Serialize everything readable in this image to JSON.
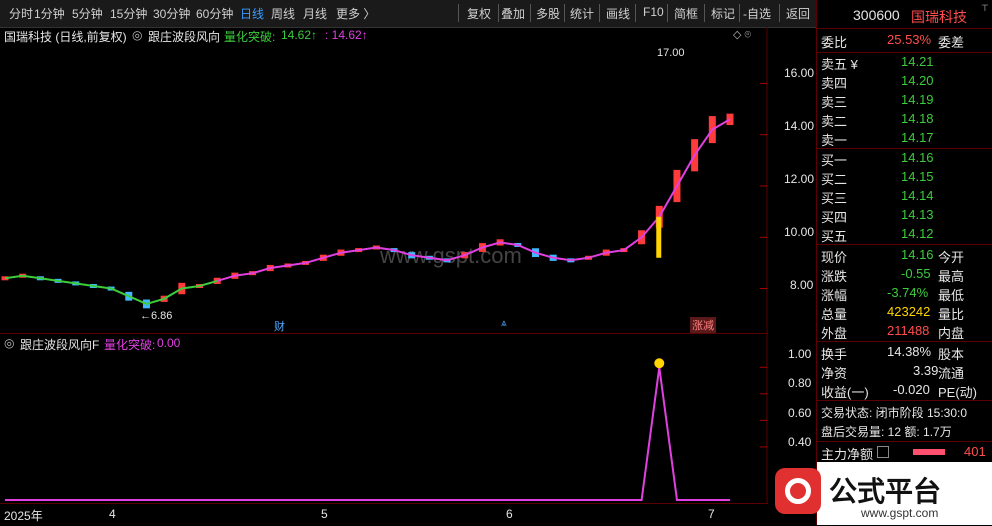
{
  "toolbar": {
    "periods": [
      "分时",
      "1分钟",
      "5分钟",
      "15分钟",
      "30分钟",
      "60分钟",
      "日线",
      "周线",
      "月线",
      "更多 〉"
    ],
    "active_period": "日线",
    "actions": [
      "复权",
      "叠加",
      "多股",
      "统计",
      "画线",
      "F10",
      "简框",
      "标记",
      "-自选",
      "返回"
    ]
  },
  "chart_title": {
    "stock": "国瑞科技 (日线,前复权)",
    "indicator": "跟庄波段风向",
    "label": "量化突破:",
    "val1": "14.62↑",
    "val2": ": 14.62↑"
  },
  "y_axis_main": [
    "16.00",
    "14.00",
    "12.00",
    "10.00",
    "8.00"
  ],
  "y_axis_sub": [
    "1.00",
    "0.80",
    "0.60",
    "0.40"
  ],
  "time_axis": [
    "2025年",
    "4",
    "5",
    "6",
    "7"
  ],
  "annotations": {
    "high": "17.00",
    "low": "←6.86",
    "event1": "财",
    "event2": "涨减"
  },
  "watermark": "www.gspt.com",
  "sub_title": {
    "name": "跟庄波段风向F",
    "label": "量化突破:",
    "value": "0.00"
  },
  "panel": {
    "code": "300600",
    "name": "国瑞科技",
    "weibi_label": "委比",
    "weibi_value": "25.53%",
    "weicha_label": "委差",
    "asks": [
      {
        "label": "卖五 ¥",
        "price": "14.21"
      },
      {
        "label": "卖四",
        "price": "14.20"
      },
      {
        "label": "卖三",
        "price": "14.19"
      },
      {
        "label": "卖二",
        "price": "14.18"
      },
      {
        "label": "卖一",
        "price": "14.17"
      }
    ],
    "bids": [
      {
        "label": "买一",
        "price": "14.16"
      },
      {
        "label": "买二",
        "price": "14.15"
      },
      {
        "label": "买三",
        "price": "14.14"
      },
      {
        "label": "买四",
        "price": "14.13"
      },
      {
        "label": "买五",
        "price": "14.12"
      }
    ],
    "quote": [
      {
        "label": "现价",
        "value": "14.16",
        "label2": "今开"
      },
      {
        "label": "涨跌",
        "value": "-0.55",
        "label2": "最高"
      },
      {
        "label": "涨幅",
        "value": "-3.74%",
        "label2": "最低"
      },
      {
        "label": "总量",
        "value": "423242",
        "label2": "量比"
      },
      {
        "label": "外盘",
        "value": "211488",
        "label2": "内盘"
      }
    ],
    "stats": [
      {
        "label": "换手",
        "value": "14.38%",
        "label2": "股本"
      },
      {
        "label": "净资",
        "value": "3.39",
        "label2": "流通"
      },
      {
        "label": "收益(一)",
        "value": "-0.020",
        "label2": "PE(动)"
      }
    ],
    "trade_status": "交易状态: 闭市阶段 15:30:0",
    "after_hours": "盘后交易量: 12  额: 1.7万",
    "main_flow_label": "主力净额",
    "main_flow_value": "401",
    "brand": "公式平台",
    "brand_url": "www.gspt.com"
  },
  "chart_data": {
    "type": "line",
    "x_ticks": [
      "2025年",
      "4",
      "5",
      "6",
      "7"
    ],
    "ylim_main": [
      6.5,
      17.5
    ],
    "y_ticks_main": [
      8,
      10,
      12,
      14,
      16
    ],
    "series": [
      {
        "color": "#e040e0",
        "values": [
          8.4,
          8.5,
          8.4,
          8.3,
          8.2,
          8.1,
          8.0,
          7.7,
          7.4,
          7.6,
          8.0,
          8.1,
          8.3,
          8.5,
          8.6,
          8.8,
          8.9,
          9.0,
          9.2,
          9.4,
          9.5,
          9.6,
          9.5,
          9.3,
          9.2,
          9.1,
          9.3,
          9.6,
          9.8,
          9.7,
          9.4,
          9.2,
          9.1,
          9.2,
          9.4,
          9.5,
          10.0,
          10.8,
          12.0,
          13.2,
          14.2,
          14.6
        ]
      }
    ],
    "ylim_sub": [
      0,
      1.1
    ],
    "y_ticks_sub": [
      0.4,
      0.6,
      0.8,
      1.0
    ],
    "signal_values": [
      0,
      0,
      0,
      0,
      0,
      0,
      0,
      0,
      0,
      0,
      0,
      0,
      0,
      0,
      0,
      0,
      0,
      0,
      0,
      0,
      0,
      0,
      0,
      0,
      0,
      0,
      0,
      0,
      0,
      0,
      0,
      0,
      0,
      0,
      0,
      0,
      0,
      1,
      0,
      0,
      0,
      0
    ]
  }
}
